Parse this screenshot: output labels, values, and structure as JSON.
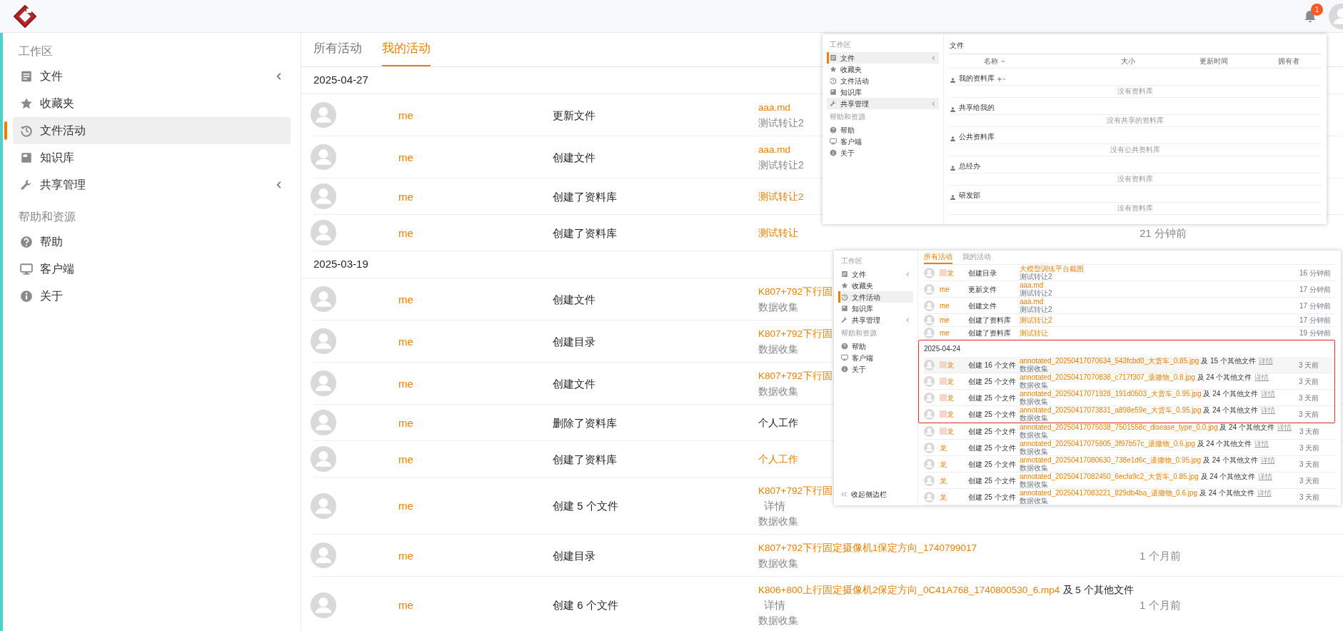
{
  "header": {
    "notification_count": "1"
  },
  "sidebar": {
    "sections": [
      {
        "heading": "工作区",
        "items": [
          {
            "label": "文件",
            "selected": false,
            "has_submenu": true
          },
          {
            "label": "收藏夹",
            "selected": false,
            "has_submenu": false
          },
          {
            "label": "文件活动",
            "selected": true,
            "has_submenu": false
          },
          {
            "label": "知识库",
            "selected": false,
            "has_submenu": false
          },
          {
            "label": "共享管理",
            "selected": false,
            "has_submenu": true
          }
        ]
      },
      {
        "heading": "帮助和资源",
        "items": [
          {
            "label": "帮助",
            "selected": false,
            "has_submenu": false
          },
          {
            "label": "客户端",
            "selected": false,
            "has_submenu": false
          },
          {
            "label": "关于",
            "selected": false,
            "has_submenu": false
          }
        ]
      }
    ]
  },
  "activity": {
    "tabs": [
      {
        "label": "所有活动",
        "selected": false
      },
      {
        "label": "我的活动",
        "selected": true
      }
    ],
    "groups": [
      {
        "date": "2025-04-27",
        "rows": [
          {
            "user": "me",
            "action": "更新文件",
            "target": "aaa.md",
            "linked": true,
            "library": "测试转让2"
          },
          {
            "user": "me",
            "action": "创建文件",
            "target": "aaa.md",
            "linked": true,
            "library": "测试转让2"
          },
          {
            "user": "me",
            "action": "创建了资料库",
            "target": "测试转让2",
            "linked": true
          },
          {
            "user": "me",
            "action": "创建了资料库",
            "target": "测试转让",
            "linked": true,
            "time": "21 分钟前"
          }
        ]
      },
      {
        "date": "2025-03-19",
        "rows": [
          {
            "user": "me",
            "action": "创建文件",
            "target": "K807+792下行固",
            "linked": true,
            "library": "数据收集"
          },
          {
            "user": "me",
            "action": "创建目录",
            "target": "K807+792下行固",
            "linked": true,
            "library": "数据收集"
          },
          {
            "user": "me",
            "action": "创建文件",
            "target": "K807+792下行固",
            "linked": true,
            "library": "数据收集"
          },
          {
            "user": "me",
            "action": "删除了资料库",
            "target": "个人工作",
            "linked": false
          },
          {
            "user": "me",
            "action": "创建了资料库",
            "target": "个人工作",
            "linked": true
          },
          {
            "user": "me",
            "action": "创建 5 个文件",
            "target": "K807+792下行固",
            "linked": true,
            "details": "详情",
            "library": "数据收集"
          },
          {
            "user": "me",
            "action": "创建目录",
            "target": "K807+792下行固定摄像机1保定方向_1740799017",
            "linked": true,
            "library": "数据收集",
            "time": "1 个月前"
          },
          {
            "user": "me",
            "action": "创建 6 个文件",
            "target": "K806+800上行固定摄像机2保定方向_0C41A768_1740800530_6.mp4",
            "linked": true,
            "extra": "及 5 个其他文件",
            "details": "详情",
            "library": "数据收集",
            "time": "1 个月前"
          }
        ]
      }
    ]
  },
  "file_browser_screenshot": {
    "sidebar": {
      "sections": [
        {
          "heading": "工作区",
          "items": [
            {
              "label": "文件",
              "selected": true,
              "highlighted": true,
              "has_submenu": true
            },
            {
              "label": "收藏夹",
              "selected": false,
              "highlighted": false,
              "has_submenu": false
            },
            {
              "label": "文件活动",
              "selected": false,
              "highlighted": false,
              "has_submenu": false
            },
            {
              "label": "知识库",
              "selected": false,
              "highlighted": false,
              "has_submenu": false
            },
            {
              "label": "共享管理",
              "selected": false,
              "highlighted": true,
              "has_submenu": true
            }
          ]
        },
        {
          "heading": "帮助和资源",
          "items": [
            {
              "label": "帮助",
              "selected": false,
              "highlighted": false,
              "has_submenu": false
            },
            {
              "label": "客户端",
              "selected": false,
              "highlighted": false,
              "has_submenu": false
            },
            {
              "label": "关于",
              "selected": false,
              "highlighted": false,
              "has_submenu": false
            }
          ]
        }
      ]
    },
    "title": "文件",
    "columns": [
      {
        "label": "名称",
        "sorted": true
      },
      {
        "label": "大小",
        "sorted": false
      },
      {
        "label": "更新时间",
        "sorted": false
      },
      {
        "label": "拥有者",
        "sorted": false
      }
    ],
    "sections": [
      {
        "name": "我的资料库",
        "add_menu": true,
        "empty_text": "没有资料库"
      },
      {
        "name": "共享给我的",
        "add_menu": false,
        "empty_text": "没有共享的资料库"
      },
      {
        "name": "公共资料库",
        "add_menu": false,
        "empty_text": "没有公共资料库"
      },
      {
        "name": "总经办",
        "add_menu": false,
        "empty_text": "没有资料库"
      },
      {
        "name": "研发部",
        "add_menu": false,
        "empty_text": "没有资料库"
      }
    ]
  },
  "activity_screenshot": {
    "sidebar": {
      "sections": [
        {
          "heading": "工作区",
          "items": [
            {
              "label": "文件",
              "selected": false,
              "highlighted": false,
              "has_submenu": true
            },
            {
              "label": "收藏夹",
              "selected": false,
              "highlighted": false,
              "has_submenu": false
            },
            {
              "label": "文件活动",
              "selected": true,
              "highlighted": true,
              "has_submenu": false
            },
            {
              "label": "知识库",
              "selected": false,
              "highlighted": false,
              "has_submenu": false
            },
            {
              "label": "共享管理",
              "selected": false,
              "highlighted": false,
              "has_submenu": true
            }
          ]
        },
        {
          "heading": "帮助和资源",
          "items": [
            {
              "label": "帮助",
              "selected": false,
              "highlighted": false,
              "has_submenu": false
            },
            {
              "label": "客户端",
              "selected": false,
              "highlighted": false,
              "has_submenu": false
            },
            {
              "label": "关于",
              "selected": false,
              "highlighted": false,
              "has_submenu": false
            }
          ]
        }
      ]
    },
    "collapse_label": "收起侧边栏",
    "tabs": [
      {
        "label": "所有活动",
        "selected": true
      },
      {
        "label": "我的活动",
        "selected": false
      }
    ],
    "groups": [
      {
        "framed": false,
        "rows": [
          {
            "user": "龙",
            "redacted": true,
            "hovered": false,
            "action": "创建目录",
            "target": "大模型训练平台截图",
            "library": "测试转让2",
            "time": "16 分钟前"
          },
          {
            "user": "me",
            "redacted": false,
            "hovered": false,
            "action": "更新文件",
            "target": "aaa.md",
            "library": "测试转让2",
            "time": "17 分钟前"
          },
          {
            "user": "me",
            "redacted": false,
            "hovered": false,
            "action": "创建文件",
            "target": "aaa.md",
            "library": "测试转让2",
            "time": "17 分钟前"
          },
          {
            "user": "me",
            "redacted": false,
            "hovered": false,
            "action": "创建了资料库",
            "target": "测试转让2",
            "time": "17 分钟前"
          },
          {
            "user": "me",
            "redacted": false,
            "hovered": false,
            "action": "创建了资料库",
            "target": "测试转让",
            "time": "19 分钟前"
          }
        ]
      },
      {
        "framed": true,
        "date": "2025-04-24",
        "rows": [
          {
            "user": "龙",
            "redacted": true,
            "hovered": true,
            "action": "创建 16 个文件",
            "target": "annotated_20250417070634_543fcbd0_大货车_0.85.jpg",
            "extra": "及 15 个其他文件",
            "details": "详情",
            "library": "数据收集",
            "time": "3 天前"
          },
          {
            "user": "龙",
            "redacted": true,
            "hovered": false,
            "action": "创建 25 个文件",
            "target": "annotated_20250417070838_c717f307_遗撒物_0.8.jpg",
            "extra": "及 24 个其他文件",
            "details": "详情",
            "library": "数据收集",
            "time": "3 天前"
          },
          {
            "user": "龙",
            "redacted": true,
            "hovered": false,
            "action": "创建 25 个文件",
            "target": "annotated_20250417071928_191d0503_大货车_0.95.jpg",
            "extra": "及 24 个其他文件",
            "details": "详情",
            "library": "数据收集",
            "time": "3 天前"
          },
          {
            "user": "龙",
            "redacted": true,
            "hovered": false,
            "action": "创建 25 个文件",
            "target": "annotated_20250417073831_a898e59e_大货车_0.95.jpg",
            "extra": "及 24 个其他文件",
            "details": "详情",
            "library": "数据收集",
            "time": "3 天前"
          }
        ]
      },
      {
        "framed": false,
        "rows": [
          {
            "user": "龙",
            "redacted": true,
            "hovered": false,
            "action": "创建 25 个文件",
            "target": "annotated_20250417075038_7501558c_disease_type_0.0.jpg",
            "extra": "及 24 个其他文件",
            "details": "详情",
            "library": "数据收集",
            "time": "3 天前"
          },
          {
            "user": "龙",
            "redacted": false,
            "hovered": false,
            "action": "创建 25 个文件",
            "target": "annotated_20250417075905_3f97b57c_遗撒物_0.6.jpg",
            "extra": "及 24 个其他文件",
            "details": "详情",
            "library": "数据收集",
            "time": "3 天前"
          },
          {
            "user": "龙",
            "redacted": false,
            "hovered": false,
            "action": "创建 25 个文件",
            "target": "annotated_20250417080630_738e1d6c_遗撒物_0.95.jpg",
            "extra": "及 24 个其他文件",
            "details": "详情",
            "library": "数据收集",
            "time": "3 天前"
          },
          {
            "user": "龙",
            "redacted": false,
            "hovered": false,
            "action": "创建 25 个文件",
            "target": "annotated_20250417082450_6ecfa9c2_大货车_0.85.jpg",
            "extra": "及 24 个其他文件",
            "details": "详情",
            "library": "数据收集",
            "time": "3 天前"
          },
          {
            "user": "龙",
            "redacted": false,
            "hovered": false,
            "action": "创建 25 个文件",
            "target": "annotated_20250417083221_829db4ba_遗撒物_0.6.jpg",
            "extra": "及 24 个其他文件",
            "details": "详情",
            "library": "数据收集",
            "time": "3 天前"
          }
        ]
      }
    ]
  }
}
